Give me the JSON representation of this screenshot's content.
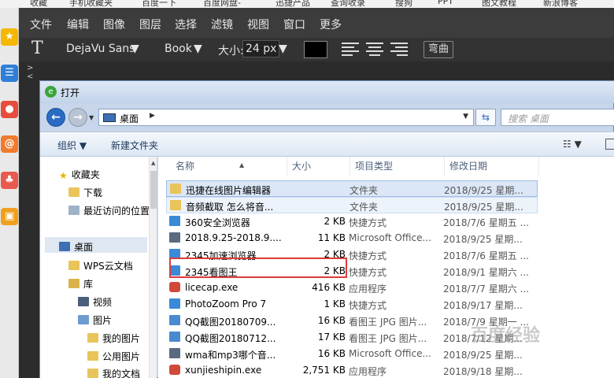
{
  "bookmarks": [
    "收藏",
    "手机收藏夹",
    "百度一下",
    "百度网盘-",
    "迅捷产品",
    "查询收录",
    "搜狗",
    "PPT",
    "图文教程",
    "新浪博客"
  ],
  "menu": [
    "文件",
    "编辑",
    "图像",
    "图层",
    "选择",
    "滤镜",
    "视图",
    "窗口",
    "更多"
  ],
  "toolbar": {
    "tool_icon": "T",
    "font": "DejaVu Sans",
    "style": "Book",
    "size_label": "大小:",
    "size_value": "24 px",
    "color": "#000000",
    "warp_label": "弯曲",
    "arrows": "> <"
  },
  "dialog": {
    "title": "打开",
    "address": "桌面",
    "search_placeholder": "搜索 桌面",
    "cmd_organize": "组织 ▼",
    "cmd_new_folder": "新建文件夹",
    "view_toggle": "☷ ▼"
  },
  "nav": {
    "favorites": "收藏夹",
    "downloads": "下载",
    "recent": "最近访问的位置",
    "desktop": "桌面",
    "wps": "WPS云文档",
    "library": "库",
    "video": "视频",
    "pictures": "图片",
    "my_pictures": "我的图片",
    "public_pictures": "公用图片",
    "my_docs": "我的文档"
  },
  "columns": [
    "名称",
    "大小",
    "项目类型",
    "修改日期"
  ],
  "files": [
    {
      "name": "迅捷在线图片编辑器",
      "size": "",
      "type": "文件夹",
      "date": "2018/9/25 星期...",
      "icon": "folder-icon"
    },
    {
      "name": "音频截取 怎么将音...",
      "size": "",
      "type": "文件夹",
      "date": "2018/9/25 星期...",
      "icon": "folder-icon"
    },
    {
      "name": "360安全浏览器",
      "size": "2 KB",
      "type": "快捷方式",
      "date": "2018/7/6 星期五 ...",
      "icon": "shortcut-icon"
    },
    {
      "name": "2018.9.25-2018.9....",
      "size": "11 KB",
      "type": "Microsoft Office...",
      "date": "2018/9/25 星期...",
      "icon": "document-icon"
    },
    {
      "name": "2345加速浏览器",
      "size": "2 KB",
      "type": "快捷方式",
      "date": "2018/7/6 星期五 ...",
      "icon": "shortcut-icon"
    },
    {
      "name": "2345看图王",
      "size": "2 KB",
      "type": "快捷方式",
      "date": "2018/9/1 星期六 ...",
      "icon": "shortcut-icon"
    },
    {
      "name": "licecap.exe",
      "size": "416 KB",
      "type": "应用程序",
      "date": "2018/7/7 星期六 ...",
      "icon": "app-icon"
    },
    {
      "name": "PhotoZoom Pro 7",
      "size": "1 KB",
      "type": "快捷方式",
      "date": "2018/9/17 星期...",
      "icon": "shortcut-icon"
    },
    {
      "name": "QQ截图20180709...",
      "size": "16 KB",
      "type": "看图王 JPG 图片...",
      "date": "2018/7/9 星期一 ...",
      "icon": "image-icon"
    },
    {
      "name": "QQ截图20180712...",
      "size": "17 KB",
      "type": "看图王 JPG 图片...",
      "date": "2018/7/12 星期...",
      "icon": "image-icon"
    },
    {
      "name": "wma和mp3哪个音...",
      "size": "16 KB",
      "type": "Microsoft Office...",
      "date": "2018/9/25 星期...",
      "icon": "document-icon"
    },
    {
      "name": "xunjieshipin.exe",
      "size": "2,751 KB",
      "type": "应用程序",
      "date": "2018/9/18 星期...",
      "icon": "app-icon"
    }
  ],
  "watermark": "百度经验"
}
